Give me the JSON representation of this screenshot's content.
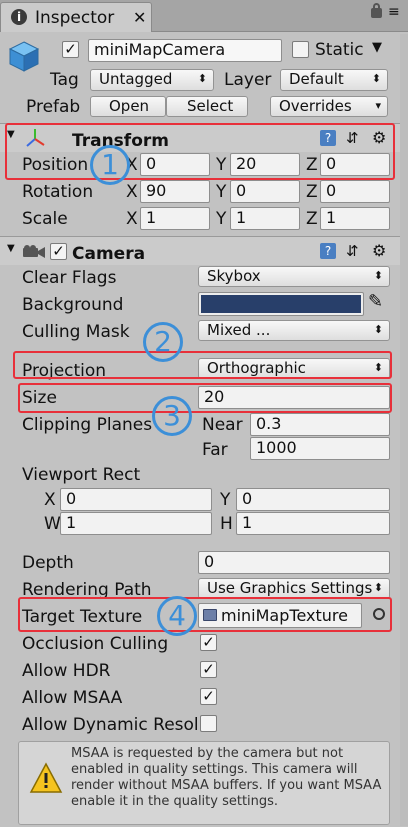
{
  "tab": {
    "title": "Inspector"
  },
  "header": {
    "object_name": "miniMapCamera",
    "static_label": "Static",
    "tag_label": "Tag",
    "tag_value": "Untagged",
    "layer_label": "Layer",
    "layer_value": "Default",
    "prefab_label": "Prefab",
    "open_label": "Open",
    "select_label": "Select",
    "overrides_label": "Overrides"
  },
  "transform": {
    "title": "Transform",
    "rows": [
      {
        "label": "Position",
        "x": "0",
        "y": "20",
        "z": "0"
      },
      {
        "label": "Rotation",
        "x": "90",
        "y": "0",
        "z": "0"
      },
      {
        "label": "Scale",
        "x": "1",
        "y": "1",
        "z": "1"
      }
    ],
    "axis": {
      "x": "X",
      "y": "Y",
      "z": "Z"
    }
  },
  "camera": {
    "title": "Camera",
    "clear_flags_label": "Clear Flags",
    "clear_flags_value": "Skybox",
    "background_label": "Background",
    "background_color": "#283f6a",
    "culling_mask_label": "Culling Mask",
    "culling_mask_value": "Mixed ...",
    "projection_label": "Projection",
    "projection_value": "Orthographic",
    "size_label": "Size",
    "size_value": "20",
    "clipping_label": "Clipping Planes",
    "near_label": "Near",
    "near_value": "0.3",
    "far_label": "Far",
    "far_value": "1000",
    "viewport_label": "Viewport Rect",
    "vx_label": "X",
    "vx_value": "0",
    "vy_label": "Y",
    "vy_value": "0",
    "vw_label": "W",
    "vw_value": "1",
    "vh_label": "H",
    "vh_value": "1",
    "depth_label": "Depth",
    "depth_value": "0",
    "rendering_path_label": "Rendering Path",
    "rendering_path_value": "Use Graphics Settings",
    "target_texture_label": "Target Texture",
    "target_texture_value": "miniMapTexture",
    "occlusion_label": "Occlusion Culling",
    "hdr_label": "Allow HDR",
    "msaa_label": "Allow MSAA",
    "dynamic_label": "Allow Dynamic Resol",
    "warning_text": "MSAA is requested by the camera but not enabled in quality settings. This camera will render without MSAA buffers. If you want MSAA enable it in the quality settings."
  },
  "annotations": [
    "1",
    "2",
    "3",
    "4"
  ],
  "accent_colors": {
    "annotation_blue": "#3c8fd8",
    "annotation_red": "#e8303a"
  }
}
